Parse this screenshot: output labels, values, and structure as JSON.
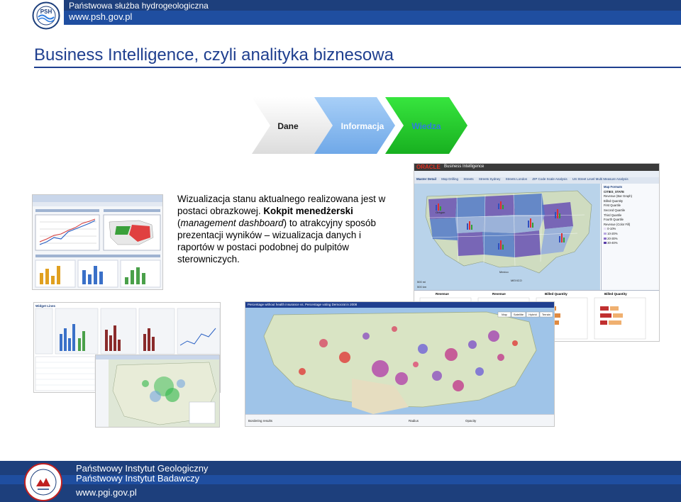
{
  "header": {
    "org_name": "Państwowa służba hydrogeologiczna",
    "url": "www.psh.gov.pl",
    "logo_text": "PSH"
  },
  "title": "Business Intelligence, czyli analityka biznesowa",
  "pyramid": {
    "steps": [
      "Dane",
      "Informacja",
      "Wiedza"
    ],
    "colors": [
      "#e6e6e6",
      "#2e7ce0",
      "#22c62a"
    ]
  },
  "description": {
    "p1": "Wizualizacja stanu aktualnego realizowana jest w postaci obrazkowej.",
    "bold": "Kokpit menedżerski",
    "em": "management dashboard",
    "p2": "to atrakcyjny sposób prezentacji wyników – wizualizacja danych i raportów w postaci podobnej do pulpitów sterowniczych."
  },
  "screenshots": {
    "oracle": {
      "brand": "ORACLE",
      "product": "Business Intelligence",
      "tabs": [
        "Master Detail",
        "Map Drilling",
        "Streets",
        "Streets Sydney",
        "Streets London",
        "ZIP Code Scale Analysis",
        "US Street Level Multi Measure Analysis"
      ],
      "formats_title": "Map Formats",
      "layer": "CITIES_STATE",
      "legend": [
        "Revenue (Bar Graph)",
        "Billed Quantity",
        "Revenue (Color Fill)",
        "0-10%",
        "10-20%",
        "20-30%",
        "30-40%"
      ],
      "quartiles": [
        "First Quartile",
        "Second Quartile",
        "Third Quartile",
        "Fourth Quartile"
      ],
      "mini_titles": [
        "Revenue",
        "Revenue",
        "Billed Quantity",
        "Billed Quantity"
      ],
      "map_labels": [
        "Oregon",
        "Mexico",
        "MEXICO"
      ],
      "scale": [
        "500 mi",
        "500 km"
      ]
    },
    "bubble_map": {
      "header": "Percentage without health insurance vs. Percentage voting Democrat in 2008",
      "map_buttons": [
        "Map",
        "Satellite",
        "Hybrid",
        "Terrain"
      ],
      "footer_labels": [
        "Bordering results",
        "Radius",
        "Opacity"
      ]
    },
    "cognos": {
      "header": "Widget Lines"
    }
  },
  "footer": {
    "line1": "Państwowy Instytut Geologiczny",
    "line2": "Państwowy Instytut Badawczy",
    "url": "www.pgi.gov.pl"
  }
}
